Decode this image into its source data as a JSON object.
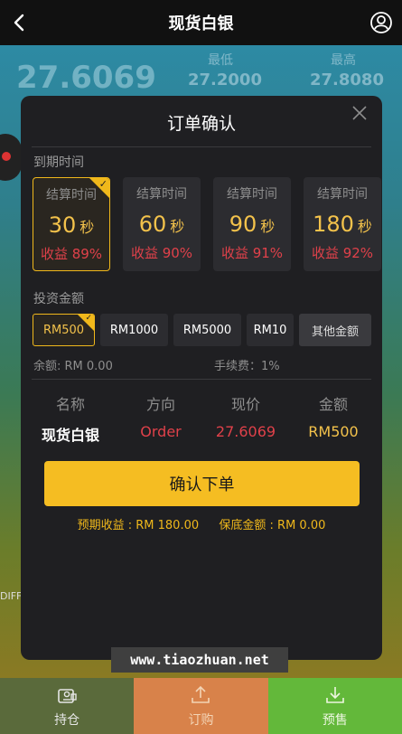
{
  "header": {
    "title": "现货白银"
  },
  "background": {
    "price": "27.6069",
    "low_label": "最低",
    "low_value": "27.2000",
    "high_label": "最高",
    "high_value": "27.8080",
    "diff_text": "DIFF"
  },
  "modal": {
    "title": "订单确认",
    "expiry_label": "到期时间",
    "time_options": [
      {
        "label": "结算时间",
        "value": "30",
        "unit": "秒",
        "yield": "收益 89%"
      },
      {
        "label": "结算时间",
        "value": "60",
        "unit": "秒",
        "yield": "收益 90%"
      },
      {
        "label": "结算时间",
        "value": "90",
        "unit": "秒",
        "yield": "收益 91%"
      },
      {
        "label": "结算时间",
        "value": "180",
        "unit": "秒",
        "yield": "收益 92%"
      }
    ],
    "amount_label": "投资金额",
    "amount_options": [
      "RM500",
      "RM1000",
      "RM5000",
      "RM10"
    ],
    "other_amount": "其他金额",
    "balance": "余额: RM 0.00",
    "fee": "手续费：1%",
    "summary_headers": [
      "名称",
      "方向",
      "现价",
      "金额"
    ],
    "summary_values": [
      "现货白银",
      "Order",
      "27.6069",
      "RM500"
    ],
    "confirm_label": "确认下单",
    "expected_label": "预期收益 : RM 180.00",
    "margin_label": "保底金额 : RM 0.00"
  },
  "watermark": "www.tiaozhuan.net",
  "tabs": [
    {
      "label": "持仓",
      "icon": "wallet-icon"
    },
    {
      "label": "订购",
      "icon": "upload-icon"
    },
    {
      "label": "预售",
      "icon": "download-icon"
    }
  ],
  "colors": {
    "accent": "#f5bd22",
    "red": "#e0414a",
    "modal_bg": "#1f1f22"
  }
}
